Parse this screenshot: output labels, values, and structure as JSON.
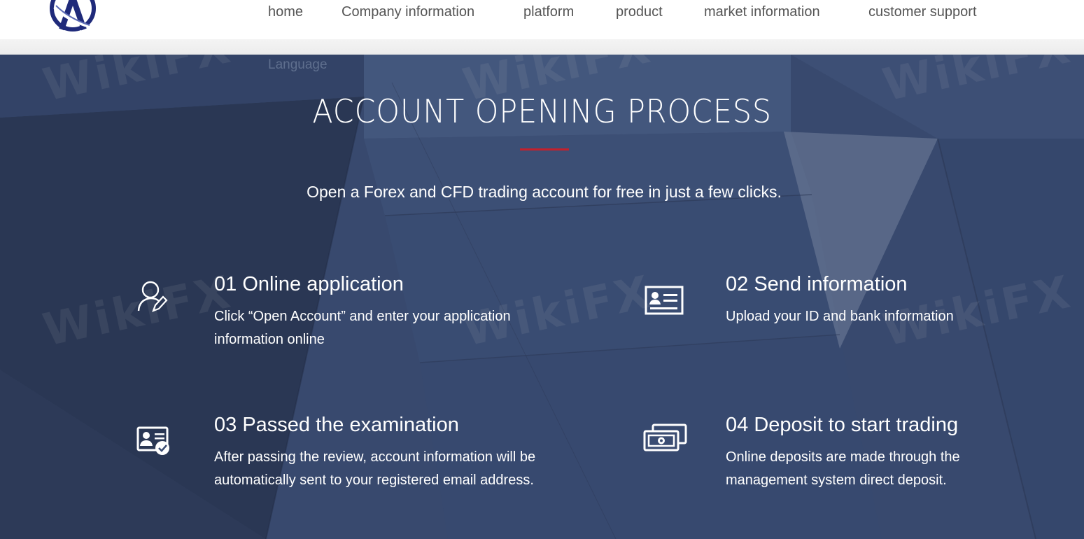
{
  "header": {
    "logo_alt": "A",
    "nav": [
      {
        "label": "home"
      },
      {
        "label": "Company information"
      },
      {
        "label": "platform"
      },
      {
        "label": "product"
      },
      {
        "label": "market information"
      },
      {
        "label": "customer support"
      }
    ],
    "language_label": "Language"
  },
  "hero": {
    "title": "ACCOUNT OPENING PROCESS",
    "subtitle": "Open a Forex and CFD trading account for free in just a few clicks.",
    "accent_color": "#c4202c"
  },
  "steps": [
    {
      "icon": "user-edit-icon",
      "title": "01 Online application",
      "description": "Click “Open Account” and enter your application information online"
    },
    {
      "icon": "id-card-icon",
      "title": "02 Send information",
      "description": "Upload your ID and bank information"
    },
    {
      "icon": "id-card-check-icon",
      "title": "03 Passed the examination",
      "description": "After passing the review, account information will be automatically sent to your registered email address."
    },
    {
      "icon": "money-bills-icon",
      "title": "04 Deposit to start trading",
      "description": "Online deposits are made through the management system direct deposit."
    }
  ],
  "watermark": "WikiFX"
}
